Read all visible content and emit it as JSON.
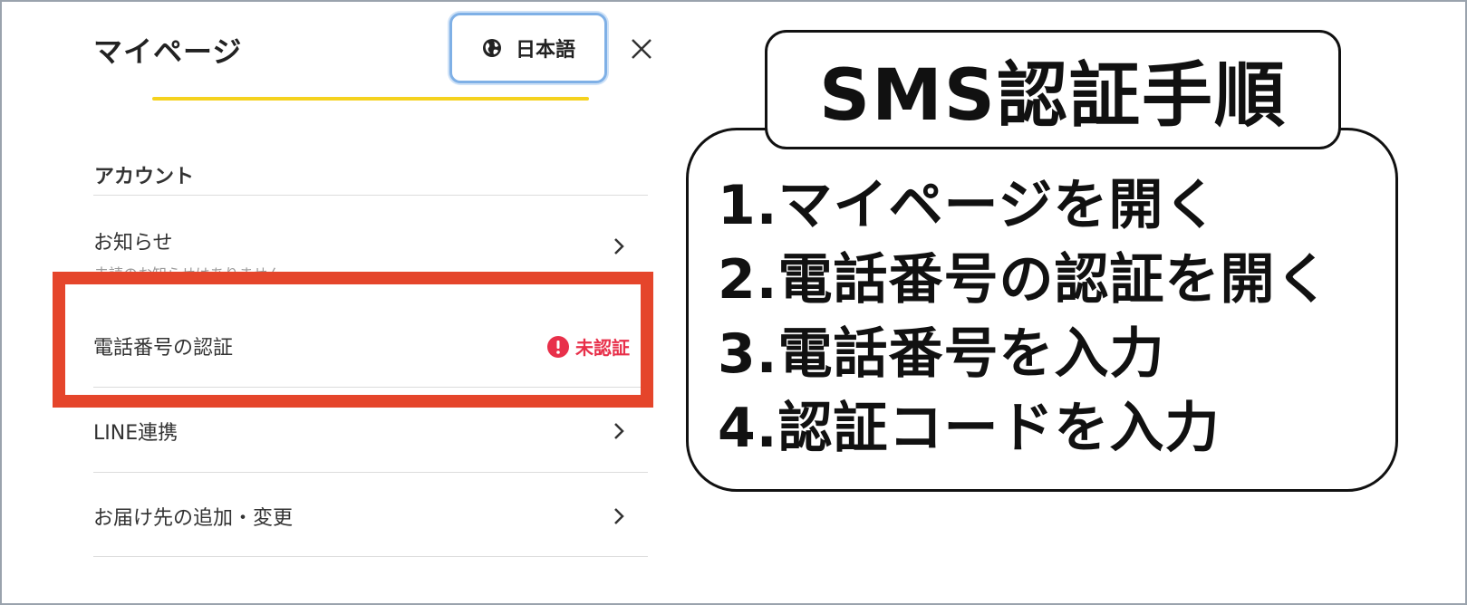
{
  "mypage": {
    "title": "マイページ",
    "language_button": {
      "label": "日本語",
      "icon": "globe-icon"
    },
    "close_icon": "close-icon",
    "accent_color": "#f5d21e",
    "section_account": "アカウント",
    "items": [
      {
        "label": "お知らせ",
        "sub": "未読のお知らせはありません",
        "icon": "chevron-right-icon"
      },
      {
        "label": "電話番号の認証",
        "status": "未認証",
        "status_icon": "alert-icon",
        "status_color": "#e8304a"
      },
      {
        "label": "LINE連携",
        "icon": "chevron-right-icon"
      },
      {
        "label": "お届け先の追加・変更",
        "icon": "chevron-right-icon"
      }
    ],
    "highlight_color": "#e5452b"
  },
  "callout": {
    "title": "SMS認証手順",
    "steps": [
      "1.マイページを開く",
      "2.電話番号の認証を開く",
      "3.電話番号を入力",
      "4.認証コードを入力"
    ]
  }
}
